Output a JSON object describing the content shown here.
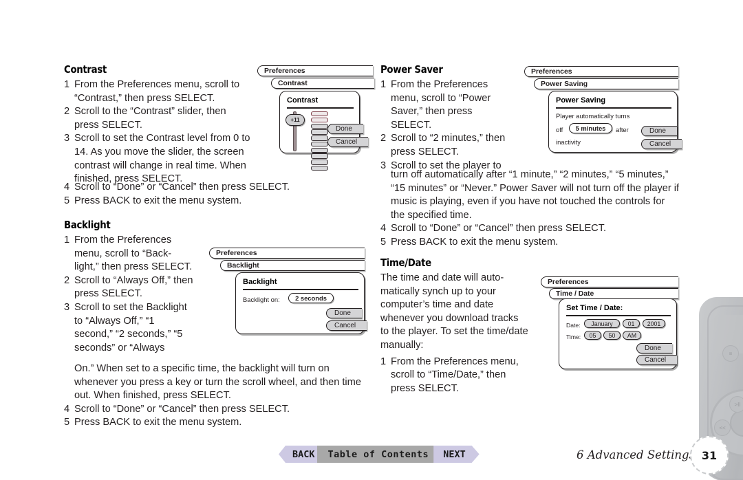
{
  "sections": {
    "contrast": {
      "heading": "Contrast",
      "steps": [
        {
          "num": "1",
          "text": "From the Preferences menu, scroll to “Contrast,” then press SELECT."
        },
        {
          "num": "2",
          "text": "Scroll to the “Contrast” slider, then press SELECT."
        },
        {
          "num": "3",
          "text": "Scroll to set the Contrast level from 0 to 14. As you move the slider, the screen contrast will change in real time. When finished, press SELECT."
        },
        {
          "num": "4",
          "text": "Scroll to “Done” or “Cancel” then press SELECT."
        },
        {
          "num": "5",
          "text": "Press BACK to exit the menu system."
        }
      ]
    },
    "backlight": {
      "heading": "Backlight",
      "steps": [
        {
          "num": "1",
          "text": "From the Preferences menu, scroll to “Back-light,” then press SELECT."
        },
        {
          "num": "2",
          "text": "Scroll to “Always Off,” then press SELECT."
        },
        {
          "num": "3",
          "text": "Scroll to set the Backlight to “Always Off,” “1 second,” “2 seconds,” “5 seconds” or “Always"
        },
        {
          "num": "",
          "text": "On.” When set to a specific time, the backlight will turn on whenever you press a key or turn the scroll wheel, and then time out. When finished, press SELECT."
        },
        {
          "num": "4",
          "text": "Scroll to “Done” or “Cancel” then press SELECT."
        },
        {
          "num": "5",
          "text": "Press BACK to exit the menu system."
        }
      ]
    },
    "power_saver": {
      "heading": "Power Saver",
      "steps": [
        {
          "num": "1",
          "text": "From the Preferences menu, scroll to “Power Saver,” then press SELECT."
        },
        {
          "num": "2",
          "text": "Scroll to “2 minutes,” then press SELECT."
        },
        {
          "num": "3",
          "text": "Scroll to set the player to"
        },
        {
          "num": "",
          "text": "turn off automatically after “1 minute,” “2 minutes,” “5 minutes,” “15 minutes” or “Never.” Power Saver will not turn off the player if music is playing, even if you have not touched the controls for the specified time."
        },
        {
          "num": "4",
          "text": "Scroll to “Done” or “Cancel” then press SELECT."
        },
        {
          "num": "5",
          "text": "Press BACK to exit the menu system."
        }
      ]
    },
    "time_date": {
      "heading": "Time/Date",
      "intro": "The time and date will auto-matically synch up to your computer’s time and date whenever you download tracks to the player. To set the time/date manually:",
      "steps": [
        {
          "num": "1",
          "text": "From the Preferences menu, scroll to “Time/Date,” then press SELECT."
        }
      ]
    }
  },
  "mocks": {
    "contrast": {
      "crumb1": "Preferences",
      "crumb2": "Contrast",
      "dialog_title": "Contrast",
      "slider_value": "+11",
      "done_label": "Done",
      "cancel_label": "Cancel",
      "bar_count": 10,
      "lit_bars": 2
    },
    "backlight": {
      "crumb1": "Preferences",
      "crumb2": "Backlight",
      "dialog_title": "Backlight",
      "field_label": "Backlight on:",
      "field_value": "2 seconds",
      "done_label": "Done",
      "cancel_label": "Cancel"
    },
    "power_saving": {
      "crumb1": "Preferences",
      "crumb2": "Power Saving",
      "dialog_title": "Power Saving",
      "line1": "Player automatically turns",
      "line2_pre": "off",
      "value": "5 minutes",
      "line2_post": "after",
      "line3": "inactivity",
      "done_label": "Done",
      "cancel_label": "Cancel"
    },
    "time_date": {
      "crumb1": "Preferences",
      "crumb2": "Time / Date",
      "dialog_title": "Set Time / Date:",
      "date_label": "Date:",
      "date_month": "January",
      "date_day": "01",
      "date_year": "2001",
      "time_label": "Time:",
      "time_hour": "05",
      "time_min": "50",
      "time_ampm": "AM",
      "done_label": "Done",
      "cancel_label": "Cancel"
    }
  },
  "footer": {
    "back_label": "BACK",
    "toc_label": "Table of Contents",
    "next_label": "NEXT",
    "chapter": "6  Advanced Settings",
    "page_number": "31"
  },
  "colors": {
    "nav_accent": "#cdc9e3",
    "nav_toc": "#a8a8a8",
    "button_fill": "#d4d4d6",
    "ink": "#231f20"
  }
}
